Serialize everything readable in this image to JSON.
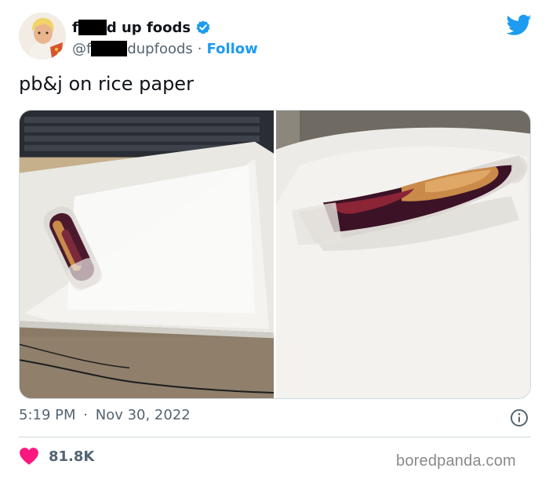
{
  "author": {
    "name_prefix": "f",
    "name_suffix": "d up foods",
    "handle_prefix": "@f",
    "handle_suffix": "dupfoods",
    "separator": "·",
    "follow_label": "Follow"
  },
  "tweet": {
    "text": "pb&j on rice paper",
    "time": "5:19 PM",
    "date_separator": "·",
    "date": "Nov 30, 2022",
    "likes": "81.8K"
  },
  "watermark": "boredpanda.com",
  "icons": {
    "verified": "verified-badge-icon",
    "bird": "twitter-bird-icon",
    "info": "info-icon",
    "heart": "heart-icon"
  },
  "colors": {
    "twitter_blue": "#1d9bf0",
    "text_primary": "#0f1419",
    "text_secondary": "#536471",
    "like_pink": "#f91880",
    "divider": "#cfd9de"
  }
}
